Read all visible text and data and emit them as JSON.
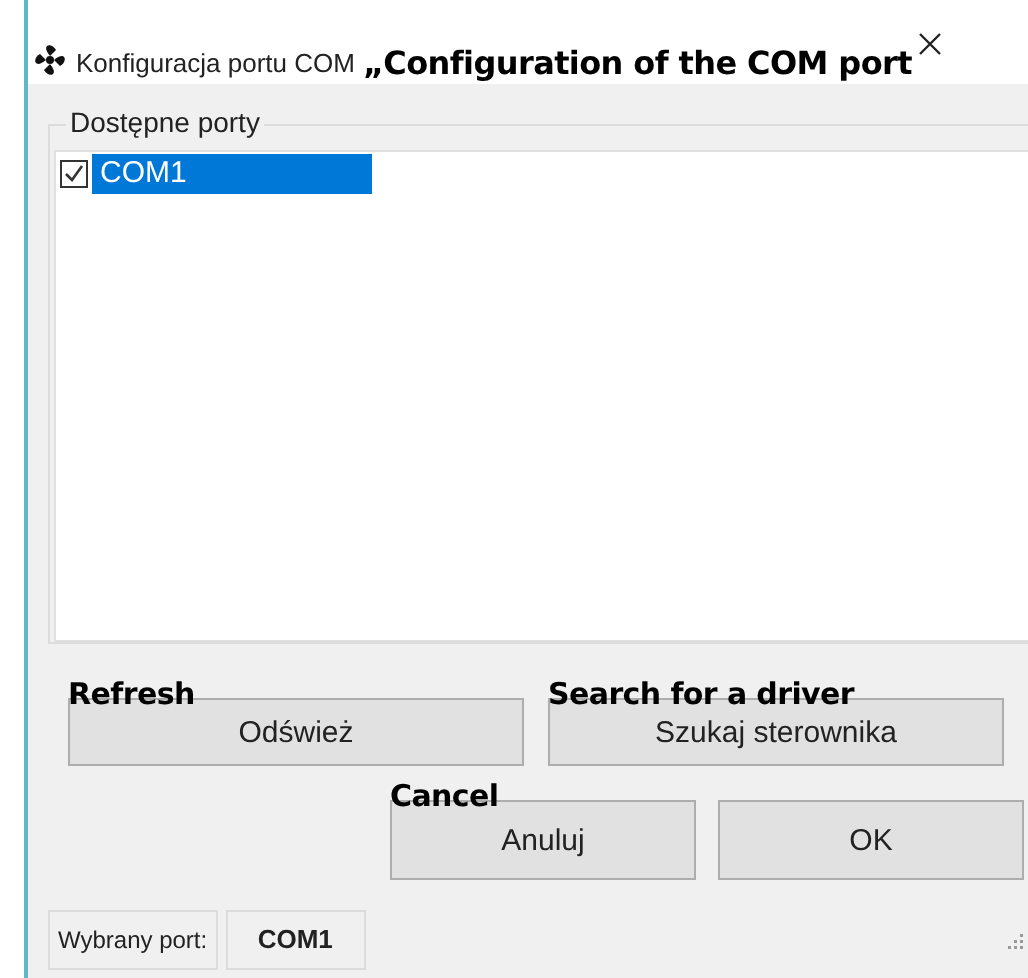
{
  "window": {
    "title": "Konfiguracja portu COM",
    "annotation": "„Configuration of the COM port"
  },
  "ports_group": {
    "title": "Dostępne porty",
    "items": [
      {
        "label": "COM1",
        "checked": true,
        "selected": true
      }
    ]
  },
  "buttons_row1": [
    {
      "label": "Odśwież",
      "annotation": "Refresh"
    },
    {
      "label": "Szukaj sterownika",
      "annotation": "Search for a driver"
    }
  ],
  "buttons_row2": [
    {
      "label": "Anuluj",
      "annotation": "Cancel"
    },
    {
      "label": "OK"
    }
  ],
  "status_bar": {
    "label": "Wybrany port:",
    "value": "COM1"
  }
}
